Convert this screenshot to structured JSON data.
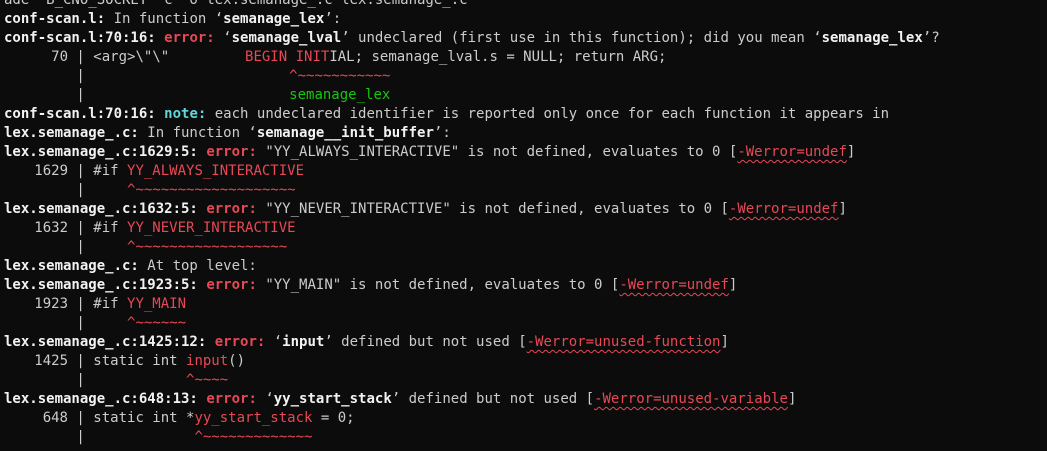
{
  "terminal": {
    "line0": "ade  B_CNO_SOCKET  c  o lex.semanage_.c lex.semanage_.c",
    "fn1": {
      "file": "conf-scan.l:",
      "text": " In function ‘",
      "name": "semanage_lex",
      "end": "’:"
    },
    "err1": {
      "loc": "conf-scan.l:70:16:",
      "kw": "error:",
      "q1": "‘",
      "ident": "semanage_lval",
      "mid": "’ undeclared (first use in this function); did you mean ‘",
      "suggest": "semanage_lex",
      "end": "’?"
    },
    "src70": {
      "num": "70",
      "bar": " | ",
      "pre": "<arg>\\\"\\\"         ",
      "hl": "BEGIN INIT",
      "post": "IAL; semanage_lval.s = NULL; return ARG;"
    },
    "caret70": {
      "bar": " |",
      "spaces": "          ",
      "marks": "^~~~~~~~~~~~"
    },
    "fix70": {
      "bar": " |",
      "spaces": "          ",
      "text": "semanage_lex"
    },
    "note1": {
      "loc": "conf-scan.l:70:16:",
      "kw": "note:",
      "text": " each undeclared identifier is reported only once for each function it appears in"
    },
    "fn2": {
      "file": "lex.semanage_.c:",
      "text": " In function ‘",
      "name": "semanage__init_buffer",
      "end": "’:"
    },
    "err2": {
      "loc": "lex.semanage_.c:1629:5:",
      "kw": "error:",
      "text": " \"YY_ALWAYS_INTERACTIVE\" is not defined, evaluates to 0 [",
      "flag": "-Werror=undef",
      "end": "]"
    },
    "src1629": {
      "num": "1629",
      "bar": " | ",
      "pre": "#if ",
      "hl": "YY_ALWAYS_INTERACTIVE"
    },
    "caret1629": {
      "bar": " |",
      "spaces": "     ",
      "marks": "^~~~~~~~~~~~~~~~~~~~"
    },
    "err3": {
      "loc": "lex.semanage_.c:1632:5:",
      "kw": "error:",
      "text": " \"YY_NEVER_INTERACTIVE\" is not defined, evaluates to 0 [",
      "flag": "-Werror=undef",
      "end": "]"
    },
    "src1632": {
      "num": "1632",
      "bar": " | ",
      "pre": "#if ",
      "hl": "YY_NEVER_INTERACTIVE"
    },
    "caret1632": {
      "bar": " |",
      "spaces": "     ",
      "marks": "^~~~~~~~~~~~~~~~~~~"
    },
    "top": {
      "file": "lex.semanage_.c:",
      "text": " At top level:"
    },
    "err4": {
      "loc": "lex.semanage_.c:1923:5:",
      "kw": "error:",
      "text": " \"YY_MAIN\" is not defined, evaluates to 0 [",
      "flag": "-Werror=undef",
      "end": "]"
    },
    "src1923": {
      "num": "1923",
      "bar": " | ",
      "pre": "#if ",
      "hl": "YY_MAIN"
    },
    "caret1923": {
      "bar": " |",
      "spaces": "     ",
      "marks": "^~~~~~~"
    },
    "err5": {
      "loc": "lex.semanage_.c:1425:12:",
      "kw": "error:",
      "q1": " ‘",
      "ident": "input",
      "text": "’ defined but not used [",
      "flag": "-Werror=unused-function",
      "end": "]"
    },
    "src1425": {
      "num": "1425",
      "bar": " | ",
      "pre": "static int ",
      "hl": "input",
      "post": "()"
    },
    "caret1425": {
      "bar": " |",
      "spaces": "            ",
      "marks": "^~~~~"
    },
    "err6": {
      "loc": "lex.semanage_.c:648:13:",
      "kw": "error:",
      "q1": " ‘",
      "ident": "yy_start_stack",
      "text": "’ defined but not used [",
      "flag": "-Werror=unused-variable",
      "end": "]"
    },
    "src648": {
      "num": "648",
      "bar": " | ",
      "pre": "static int *",
      "hl": "yy_start_stack",
      "post": " = 0;"
    },
    "caret648": {
      "bar": " |",
      "spaces": "             ",
      "marks": "^~~~~~~~~~~~~~"
    }
  },
  "colors": {
    "background": "#0c0c0c",
    "text": "#cccccc",
    "error": "#e74856",
    "note": "#61d6d6",
    "fixit": "#16c60c"
  }
}
